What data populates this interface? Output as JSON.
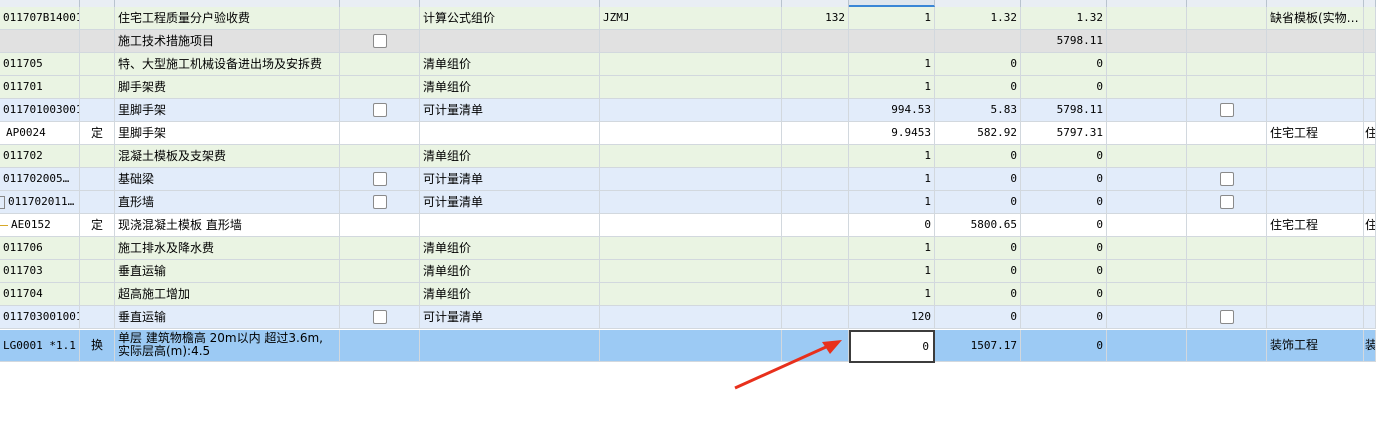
{
  "rows": [
    {
      "style": "g",
      "code": "011707B14001",
      "type": "",
      "name": "住宅工程质量分户验收费",
      "cb": false,
      "method": "计算公式组价",
      "basis": "JZMJ",
      "rate": "132",
      "qty": "1",
      "price": "1.32",
      "total": "1.32",
      "cb2": false,
      "remark": "缺省模板(实物…",
      "last": ""
    },
    {
      "style": "gr",
      "code": "",
      "type": "",
      "name": "施工技术措施项目",
      "cb": true,
      "method": "",
      "basis": "",
      "rate": "",
      "qty": "",
      "price": "",
      "total": "5798.11",
      "cb2": false,
      "remark": "",
      "last": ""
    },
    {
      "style": "g",
      "code": "011705",
      "type": "",
      "name": "特、大型施工机械设备进出场及安拆费",
      "cb": false,
      "method": "清单组价",
      "basis": "",
      "rate": "",
      "qty": "1",
      "price": "0",
      "total": "0",
      "cb2": false,
      "remark": "",
      "last": ""
    },
    {
      "style": "g",
      "code": "011701",
      "type": "",
      "name": "脚手架费",
      "cb": false,
      "method": "清单组价",
      "basis": "",
      "rate": "",
      "qty": "1",
      "price": "0",
      "total": "0",
      "cb2": false,
      "remark": "",
      "last": ""
    },
    {
      "style": "b",
      "code": "011701003001",
      "type": "",
      "name": "里脚手架",
      "cb": true,
      "method": "可计量清单",
      "basis": "",
      "rate": "",
      "qty": "994.53",
      "price": "5.83",
      "total": "5798.11",
      "cb2": true,
      "remark": "",
      "last": ""
    },
    {
      "style": "w",
      "code": "AP0024",
      "type": "定",
      "name": "里脚手架",
      "cb": false,
      "method": "",
      "basis": "",
      "rate": "",
      "qty": "9.9453",
      "price": "582.92",
      "total": "5797.31",
      "cb2": false,
      "remark": "住宅工程",
      "last": "住"
    },
    {
      "style": "g",
      "code": "011702",
      "type": "",
      "name": "混凝土模板及支架费",
      "cb": false,
      "method": "清单组价",
      "basis": "",
      "rate": "",
      "qty": "1",
      "price": "0",
      "total": "0",
      "cb2": false,
      "remark": "",
      "last": ""
    },
    {
      "style": "b",
      "code": "011702005…",
      "type": "",
      "name": "基础梁",
      "cb": true,
      "method": "可计量清单",
      "basis": "",
      "rate": "",
      "qty": "1",
      "price": "0",
      "total": "0",
      "cb2": true,
      "remark": "",
      "last": ""
    },
    {
      "style": "b",
      "code": "011702011…",
      "type": "",
      "name": "直形墙",
      "cb": true,
      "method": "可计量清单",
      "basis": "",
      "rate": "",
      "qty": "1",
      "price": "0",
      "total": "0",
      "cb2": true,
      "remark": "",
      "last": ""
    },
    {
      "style": "w",
      "code": "AE0152",
      "type": "定",
      "name": "现浇混凝土模板 直形墙",
      "cb": false,
      "method": "",
      "basis": "",
      "rate": "",
      "qty": "0",
      "price": "5800.65",
      "total": "0",
      "cb2": false,
      "remark": "住宅工程",
      "last": "住"
    },
    {
      "style": "g",
      "code": "011706",
      "type": "",
      "name": "施工排水及降水费",
      "cb": false,
      "method": "清单组价",
      "basis": "",
      "rate": "",
      "qty": "1",
      "price": "0",
      "total": "0",
      "cb2": false,
      "remark": "",
      "last": ""
    },
    {
      "style": "g",
      "code": "011703",
      "type": "",
      "name": "垂直运输",
      "cb": false,
      "method": "清单组价",
      "basis": "",
      "rate": "",
      "qty": "1",
      "price": "0",
      "total": "0",
      "cb2": false,
      "remark": "",
      "last": ""
    },
    {
      "style": "g",
      "code": "011704",
      "type": "",
      "name": "超高施工增加",
      "cb": false,
      "method": "清单组价",
      "basis": "",
      "rate": "",
      "qty": "1",
      "price": "0",
      "total": "0",
      "cb2": false,
      "remark": "",
      "last": ""
    },
    {
      "style": "b",
      "code": "011703001001",
      "type": "",
      "name": "垂直运输",
      "cb": true,
      "method": "可计量清单",
      "basis": "",
      "rate": "",
      "qty": "120",
      "price": "0",
      "total": "0",
      "cb2": true,
      "remark": "",
      "last": ""
    }
  ],
  "selected_row": {
    "code": "LG0001 *1.1",
    "type": "换",
    "name_line1": "单层 建筑物檐高 20m以内  超过3.6m,",
    "name_line2": "实际层高(m):4.5",
    "qty": "0",
    "price": "1507.17",
    "total": "0",
    "remark": "装饰工程",
    "last": "装"
  },
  "colors": {
    "arrow": "#e8301c",
    "selected": "#9ccaf4",
    "measure_row": "#e2ecfa",
    "group_row": "#eaf4e3"
  }
}
